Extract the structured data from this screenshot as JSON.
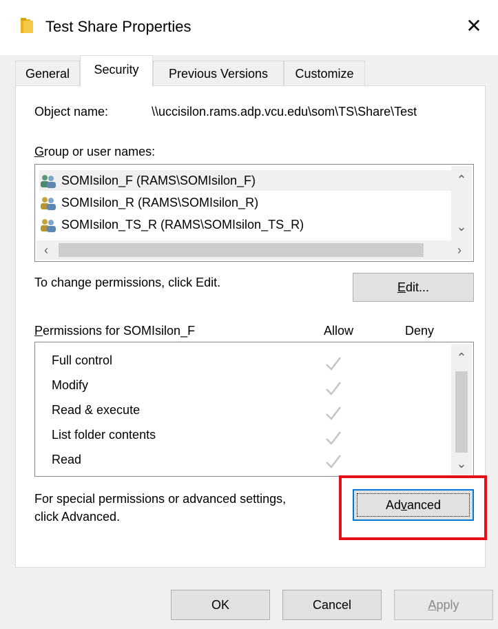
{
  "window": {
    "title": "Test Share Properties",
    "close_glyph": "✕"
  },
  "tabs": [
    {
      "label": "General"
    },
    {
      "label": "Security"
    },
    {
      "label": "Previous Versions"
    },
    {
      "label": "Customize"
    }
  ],
  "security": {
    "object_name_label": "Object name:",
    "object_name_value": "\\\\uccisilon.rams.adp.vcu.edu\\som\\TS\\Share\\Test",
    "group_label_prefix": "G",
    "group_label_rest": "roup or user names:",
    "groups": [
      {
        "name": "SOMIsilon_F (RAMS\\SOMIsilon_F)",
        "icon": "users-icon"
      },
      {
        "name": "SOMIsilon_R (RAMS\\SOMIsilon_R)",
        "icon": "users-icon"
      },
      {
        "name": "SOMIsilon_TS_R (RAMS\\SOMIsilon_TS_R)",
        "icon": "users-icon"
      }
    ],
    "change_text": "To change permissions, click Edit.",
    "edit_button_prefix": "E",
    "edit_button_rest": "dit...",
    "permissions_label_prefix": "P",
    "permissions_label_rest": "ermissions for SOMIsilon_F",
    "allow_header": "Allow",
    "deny_header": "Deny",
    "permissions": [
      {
        "name": "Full control",
        "allow": true,
        "deny": false
      },
      {
        "name": "Modify",
        "allow": true,
        "deny": false
      },
      {
        "name": "Read & execute",
        "allow": true,
        "deny": false
      },
      {
        "name": "List folder contents",
        "allow": true,
        "deny": false
      },
      {
        "name": "Read",
        "allow": true,
        "deny": false
      }
    ],
    "advanced_text_line1": "For special permissions or advanced settings,",
    "advanced_text_line2": "click Advanced.",
    "advanced_button_pre": "Ad",
    "advanced_button_ul": "v",
    "advanced_button_post": "anced"
  },
  "footer": {
    "ok_label": "OK",
    "cancel_label": "Cancel",
    "apply_prefix": "A",
    "apply_rest": "pply"
  },
  "colors": {
    "highlight_box": "#e3101a",
    "focus_blue": "#0078d7",
    "check_gray": "#c4c4c4"
  }
}
